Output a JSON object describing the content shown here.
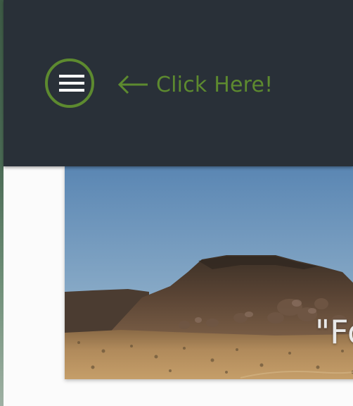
{
  "header": {
    "menu_button": {
      "icon": "hamburger-menu-icon",
      "ring_color": "#5d8a2f"
    },
    "hint": {
      "icon": "left-arrow-icon",
      "text": "Click Here!",
      "color": "#5d8a2f"
    },
    "background": "#293038"
  },
  "hero": {
    "image": "desert-mesa-landscape",
    "quote_text": "\"Fo"
  }
}
